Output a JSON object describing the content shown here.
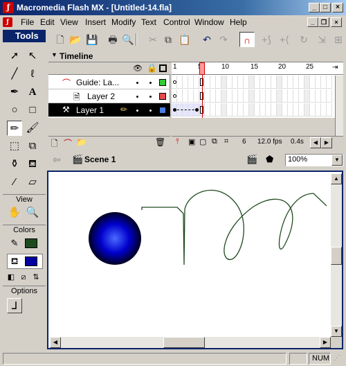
{
  "window": {
    "title": "Macromedia Flash MX - [Untitled-14.fla]",
    "controls": [
      "_",
      "□",
      "×"
    ]
  },
  "menubar": {
    "items": [
      "File",
      "Edit",
      "View",
      "Insert",
      "Modify",
      "Text",
      "Control",
      "Window",
      "Help"
    ]
  },
  "tools": {
    "title": "Tools",
    "view_label": "View",
    "colors_label": "Colors",
    "options_label": "Options",
    "stroke_color": "#1e4a1e",
    "fill_color": "#0000a0"
  },
  "timeline": {
    "title": "Timeline",
    "frame_numbers": [
      "1",
      "5",
      "10",
      "15",
      "20",
      "25"
    ],
    "layers": [
      {
        "name": "Guide: La...",
        "type": "guide",
        "color": "#33cc33",
        "selected": false
      },
      {
        "name": "Layer 2",
        "type": "guided",
        "color": "#e64a4a",
        "selected": false
      },
      {
        "name": "Layer 1",
        "type": "normal",
        "color": "#4a7ee6",
        "selected": true
      }
    ],
    "current_frame": "6",
    "fps": "12.0 fps",
    "elapsed": "0.4s"
  },
  "editbar": {
    "scene": "Scene 1",
    "zoom": "100%"
  },
  "stage": {
    "circle_color": "#0000cc",
    "path_color": "#1e4a1e"
  },
  "status": {
    "num": "NUM"
  }
}
